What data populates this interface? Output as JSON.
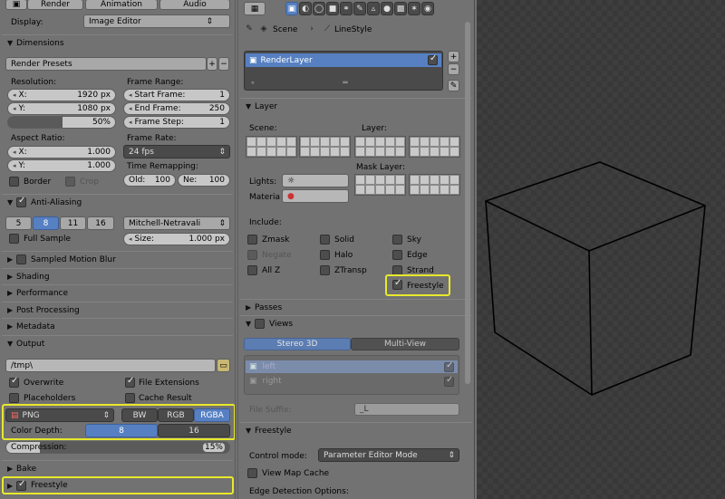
{
  "left": {
    "tabs": [
      "Render",
      "Animation",
      "Audio"
    ],
    "display_label": "Display:",
    "display_value": "Image Editor",
    "dimensions": {
      "title": "Dimensions",
      "presets": "Render Presets",
      "resolution_label": "Resolution:",
      "x_label": "X:",
      "x": "1920 px",
      "y_label": "Y:",
      "y": "1080 px",
      "pct": "50%",
      "frame_range_label": "Frame Range:",
      "start_label": "Start Frame:",
      "start": "1",
      "end_label": "End Frame:",
      "end": "250",
      "step_label": "Frame Step:",
      "step": "1",
      "aspect_label": "Aspect Ratio:",
      "ax_label": "X:",
      "ax": "1.000",
      "ay_label": "Y:",
      "ay": "1.000",
      "frame_rate_label": "Frame Rate:",
      "fps": "24 fps",
      "remap_label": "Time Remapping:",
      "old_label": "Old:",
      "old": "100",
      "new_label": "Ne:",
      "new": "100",
      "border": "Border",
      "crop": "Crop"
    },
    "aa": {
      "title": "Anti-Aliasing",
      "samples": [
        "5",
        "8",
        "11",
        "16"
      ],
      "filter": "Mitchell-Netravali",
      "full_sample": "Full Sample",
      "size_label": "Size:",
      "size": "1.000 px"
    },
    "sections": [
      "Sampled Motion Blur",
      "Shading",
      "Performance",
      "Post Processing",
      "Metadata"
    ],
    "output": {
      "title": "Output",
      "path": "/tmp\\",
      "overwrite": "Overwrite",
      "file_ext": "File Extensions",
      "placeholders": "Placeholders",
      "cache": "Cache Result",
      "format": "PNG",
      "modes": [
        "BW",
        "RGB",
        "RGBA"
      ],
      "depth_label": "Color Depth:",
      "depths": [
        "8",
        "16"
      ],
      "compression_label": "Compression:",
      "compression": "15%"
    },
    "bake": "Bake",
    "freestyle": "Freestyle"
  },
  "mid": {
    "breadcrumb_scene": "Scene",
    "breadcrumb_ls": "LineStyle",
    "render_layer": "RenderLayer",
    "layer": {
      "title": "Layer",
      "scene": "Scene:",
      "layer": "Layer:",
      "lights": "Lights:",
      "material": "Materia",
      "mask": "Mask Layer:",
      "include": "Include:",
      "inc": [
        [
          "Zmask",
          "Solid",
          "Sky"
        ],
        [
          "Negate",
          "Halo",
          "Edge"
        ],
        [
          "All Z",
          "ZTransp",
          "Strand"
        ]
      ],
      "freestyle": "Freestyle"
    },
    "passes": "Passes",
    "views": "Views",
    "stereo": "Stereo 3D",
    "multiview": "Multi-View",
    "left": "left",
    "right": "right",
    "suffix_label": "File Suffix:",
    "suffix": "_L",
    "freestyle": {
      "title": "Freestyle",
      "control_label": "Control mode:",
      "control": "Parameter Editor Mode",
      "view_map": "View Map Cache",
      "edge": "Edge Detection Options:"
    }
  }
}
